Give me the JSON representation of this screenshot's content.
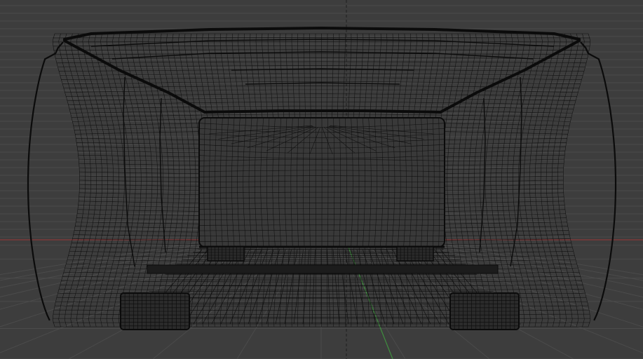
{
  "viewport": {
    "view": "front-orthographic",
    "shading": "wireframe",
    "background_color": "#3d3d3d",
    "grid_color": "#4b4b4b",
    "wire_color": "#0b0b0b",
    "x_axis_color": "#8a3a3a",
    "y_axis_color": "#3f8f3f",
    "origin_line_color": "#1e1e1e",
    "object": "sofa-mesh"
  }
}
